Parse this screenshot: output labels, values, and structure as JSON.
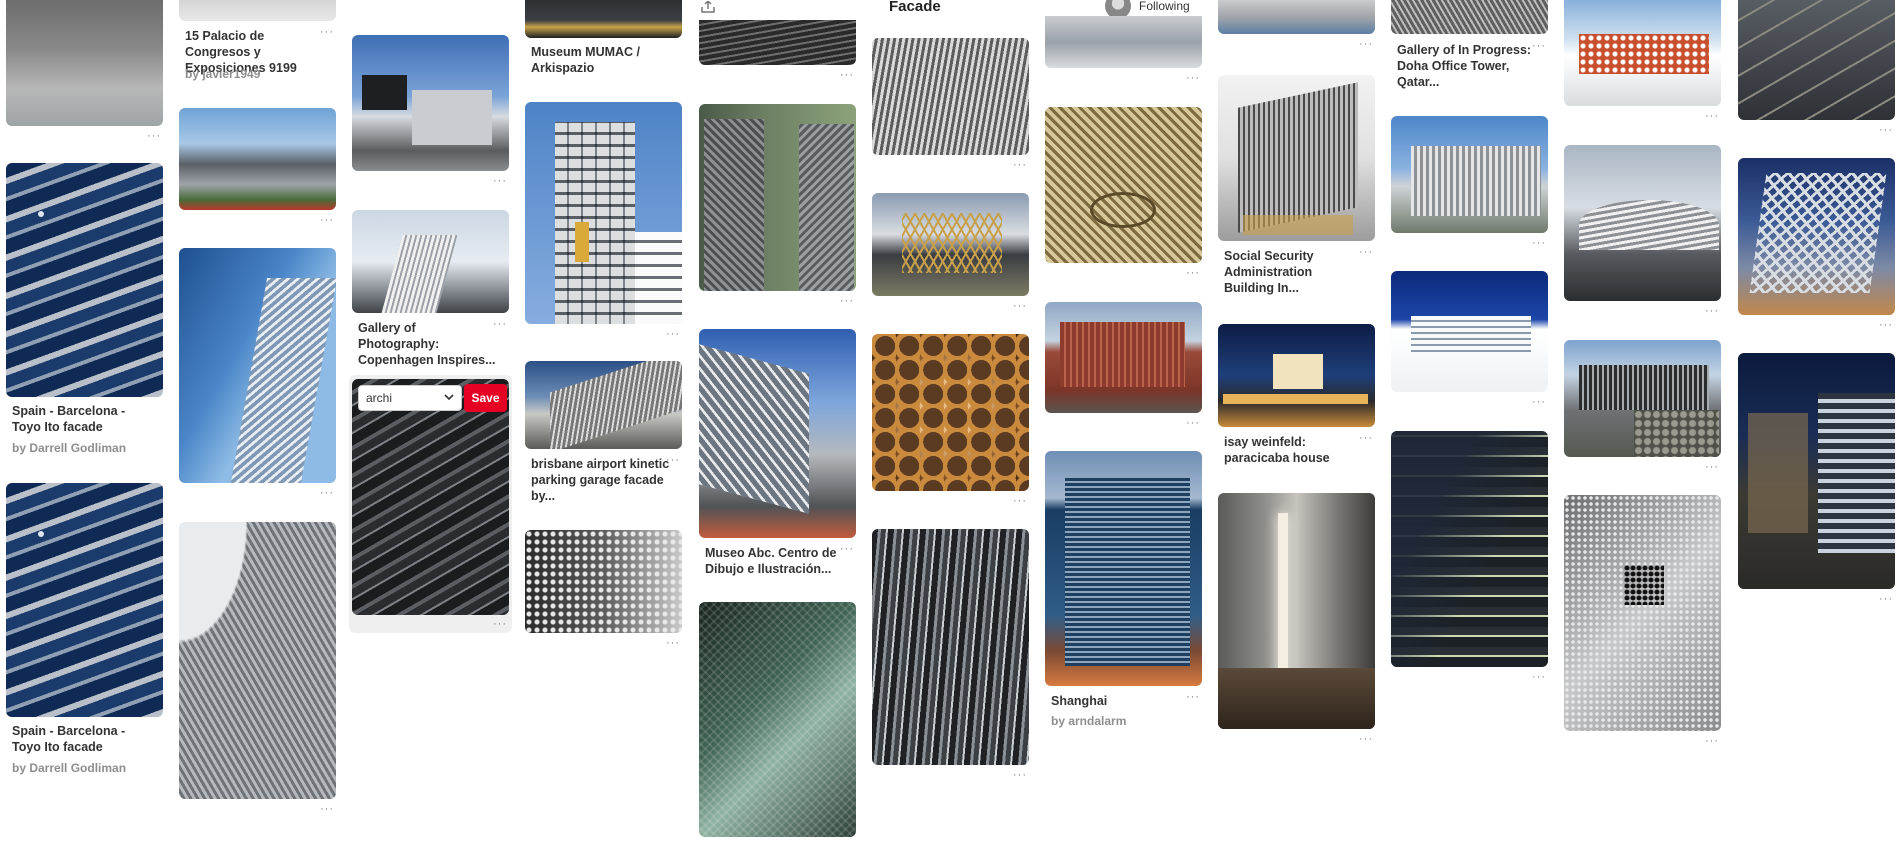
{
  "header": {
    "board_title": "Facade",
    "following_label": "Following"
  },
  "pins": {
    "c1p2": {
      "title": "Spain - Barcelona - Toyo Ito facade",
      "by": "by Darrell Godliman"
    },
    "c1p3": {
      "title": "Spain - Barcelona - Toyo Ito facade",
      "by": "by Darrell Godliman"
    },
    "c2p1": {
      "title": "15 Palacio de Congresos y Exposiciones 9199",
      "by": "by javier1949"
    },
    "c3p2": {
      "title": "Gallery of Photography: Copenhagen Inspires..."
    },
    "c3p3": {
      "board_select": "archi",
      "save_label": "Save"
    },
    "c4p1": {
      "title": "Museum MUMAC / Arkispazio"
    },
    "c4p3": {
      "title": "brisbane airport kinetic parking garage facade by..."
    },
    "c5p3": {
      "title": "Museo Abc. Centro de Dibujo e Ilustración..."
    },
    "c7p4": {
      "title": "Shanghai",
      "by": "by arndalarm"
    },
    "c8p2": {
      "title": "Social Security Administration Building In..."
    },
    "c8p3": {
      "title": "isay weinfeld: paracicaba house"
    },
    "c9p1": {
      "title": "Gallery of In Progress: Doha Office Tower, Qatar..."
    }
  },
  "more_label": "···",
  "colors": {
    "save": "#e60023",
    "bg": "#ffffff"
  }
}
